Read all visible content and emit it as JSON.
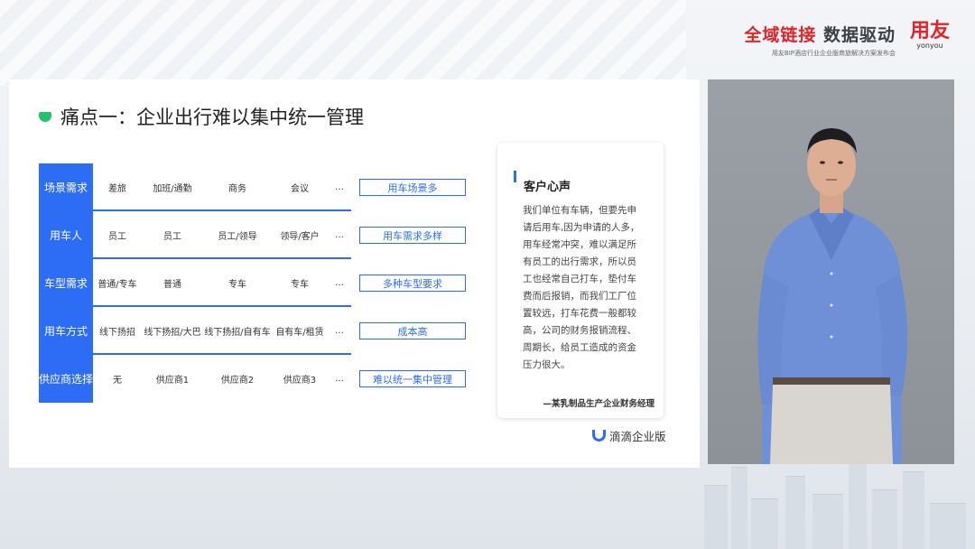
{
  "header": {
    "tagline_part1": "全域链接",
    "tagline_part2": "数据驱动",
    "subtitle": "用友BIP酒店行业企业版商旅解决方案发布会",
    "brand_cn": "用友",
    "brand_en": "yonyou"
  },
  "slide": {
    "title": "痛点一：企业出行难以集中统一管理",
    "rows": [
      {
        "category": "场景需求",
        "cells": [
          "差旅",
          "加班/通勤",
          "商务",
          "会议",
          "…"
        ],
        "result": "用车场景多"
      },
      {
        "category": "用车人",
        "cells": [
          "员工",
          "员工",
          "员工/领导",
          "领导/客户",
          "…"
        ],
        "result": "用车需求多样"
      },
      {
        "category": "车型需求",
        "cells": [
          "普通/专车",
          "普通",
          "专车",
          "专车",
          "…"
        ],
        "result": "多种车型要求"
      },
      {
        "category": "用车方式",
        "cells": [
          "线下扬招",
          "线下扬招/大巴",
          "线下扬招/自有车",
          "自有车/租赁",
          "…"
        ],
        "result": "成本高"
      },
      {
        "category": "供应商选择",
        "cells": [
          "无",
          "供应商1",
          "供应商2",
          "供应商3",
          "…"
        ],
        "result": "难以统一集中管理"
      }
    ],
    "voice": {
      "title": "客户心声",
      "body": "我们单位有车辆，但要先申请后用车,因为申请的人多，用车经常冲突，难以满足所有员工的出行需求，所以员工也经常自己打车，垫付车费而后报销，而我们工厂位置较远，打车花费一般都较高，公司的财务报销流程、周期长，给员工造成的资金压力很大。",
      "signature": "—某乳制品生产企业财务经理"
    },
    "logo_label": "滴滴企业版"
  },
  "colors": {
    "accent": "#2d6df6",
    "brand_red": "#e1242b",
    "title_icon": "#25c16f"
  }
}
